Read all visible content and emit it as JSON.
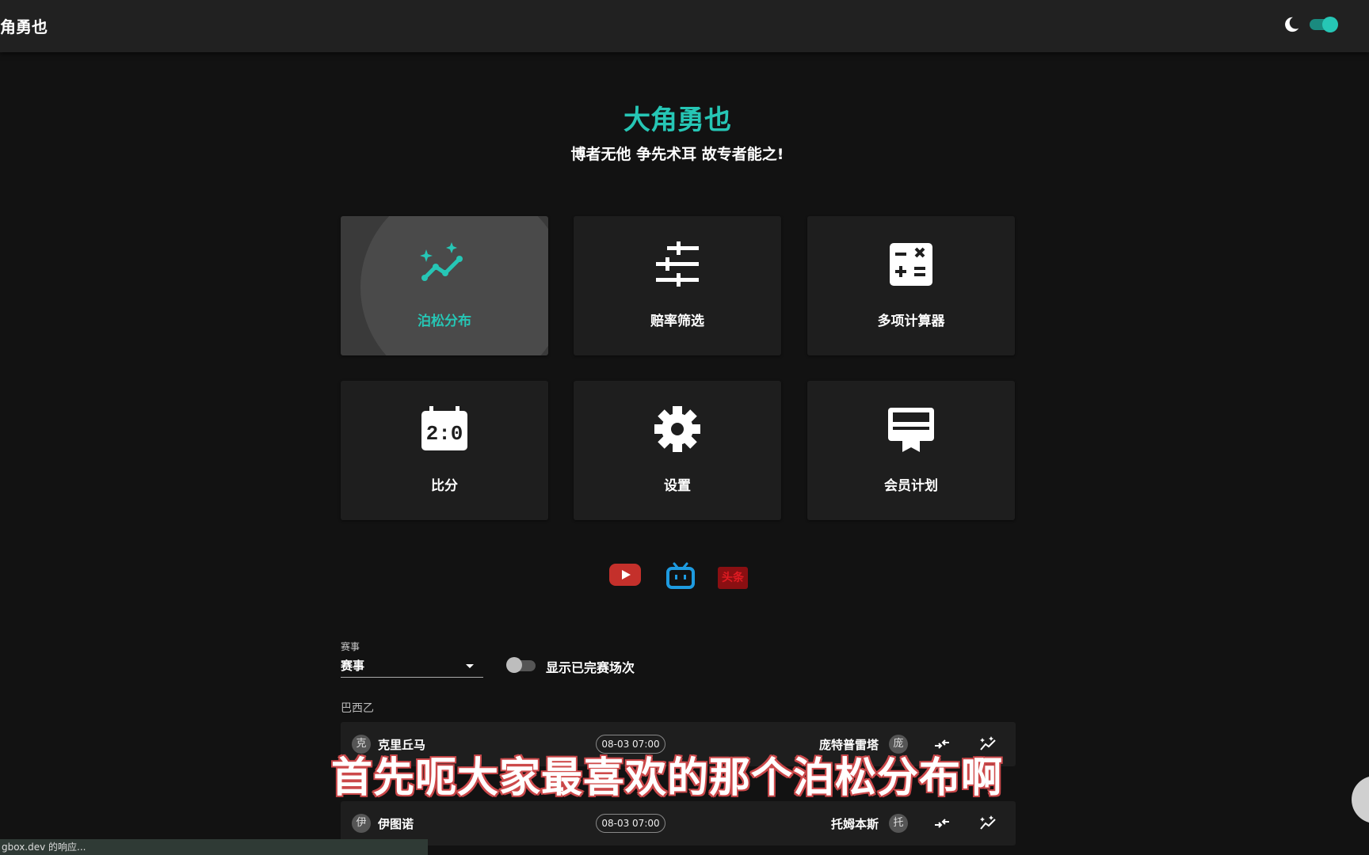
{
  "appbar": {
    "title": "角勇也",
    "theme_icon": "moon-icon",
    "theme_toggle_on": true
  },
  "brand": {
    "title": "大角勇也",
    "subtitle": "博者无他 争先术耳 故专者能之!"
  },
  "menu": [
    {
      "label": "泊松分布",
      "icon": "poisson-chart-icon",
      "active": true
    },
    {
      "label": "赔率筛选",
      "icon": "filter-sliders-icon"
    },
    {
      "label": "多项计算器",
      "icon": "calculator-icon"
    },
    {
      "label": "比分",
      "icon": "scoreboard-icon"
    },
    {
      "label": "设置",
      "icon": "gear-icon"
    },
    {
      "label": "会员计划",
      "icon": "membership-card-icon"
    }
  ],
  "social": [
    {
      "name": "youtube",
      "icon": "youtube-icon",
      "color": "#c4302b"
    },
    {
      "name": "bilibili",
      "icon": "bilibili-icon",
      "color": "#1e9be0"
    },
    {
      "name": "toutiao",
      "icon": "toutiao-icon",
      "color": "#d7191c",
      "text": "头条"
    }
  ],
  "filters": {
    "event_label": "赛事",
    "event_value": "赛事",
    "show_finished_label": "显示已完赛场次",
    "show_finished": false
  },
  "league": "巴西乙",
  "matches": [
    {
      "home_initial": "克",
      "home": "克里丘马",
      "time": "08-03 07:00",
      "away": "庞特普雷塔",
      "away_initial": "庞"
    },
    {
      "home_initial": "伊",
      "home": "伊图诺",
      "time": "08-03 07:00",
      "away": "托姆本斯",
      "away_initial": "托"
    }
  ],
  "subtitle_caption": "首先呃大家最喜欢的那个泊松分布啊",
  "status_text": "gbox.dev 的响应...",
  "colors": {
    "accent": "#26c6b5",
    "background": "#121212",
    "card": "#1e1e1e"
  }
}
